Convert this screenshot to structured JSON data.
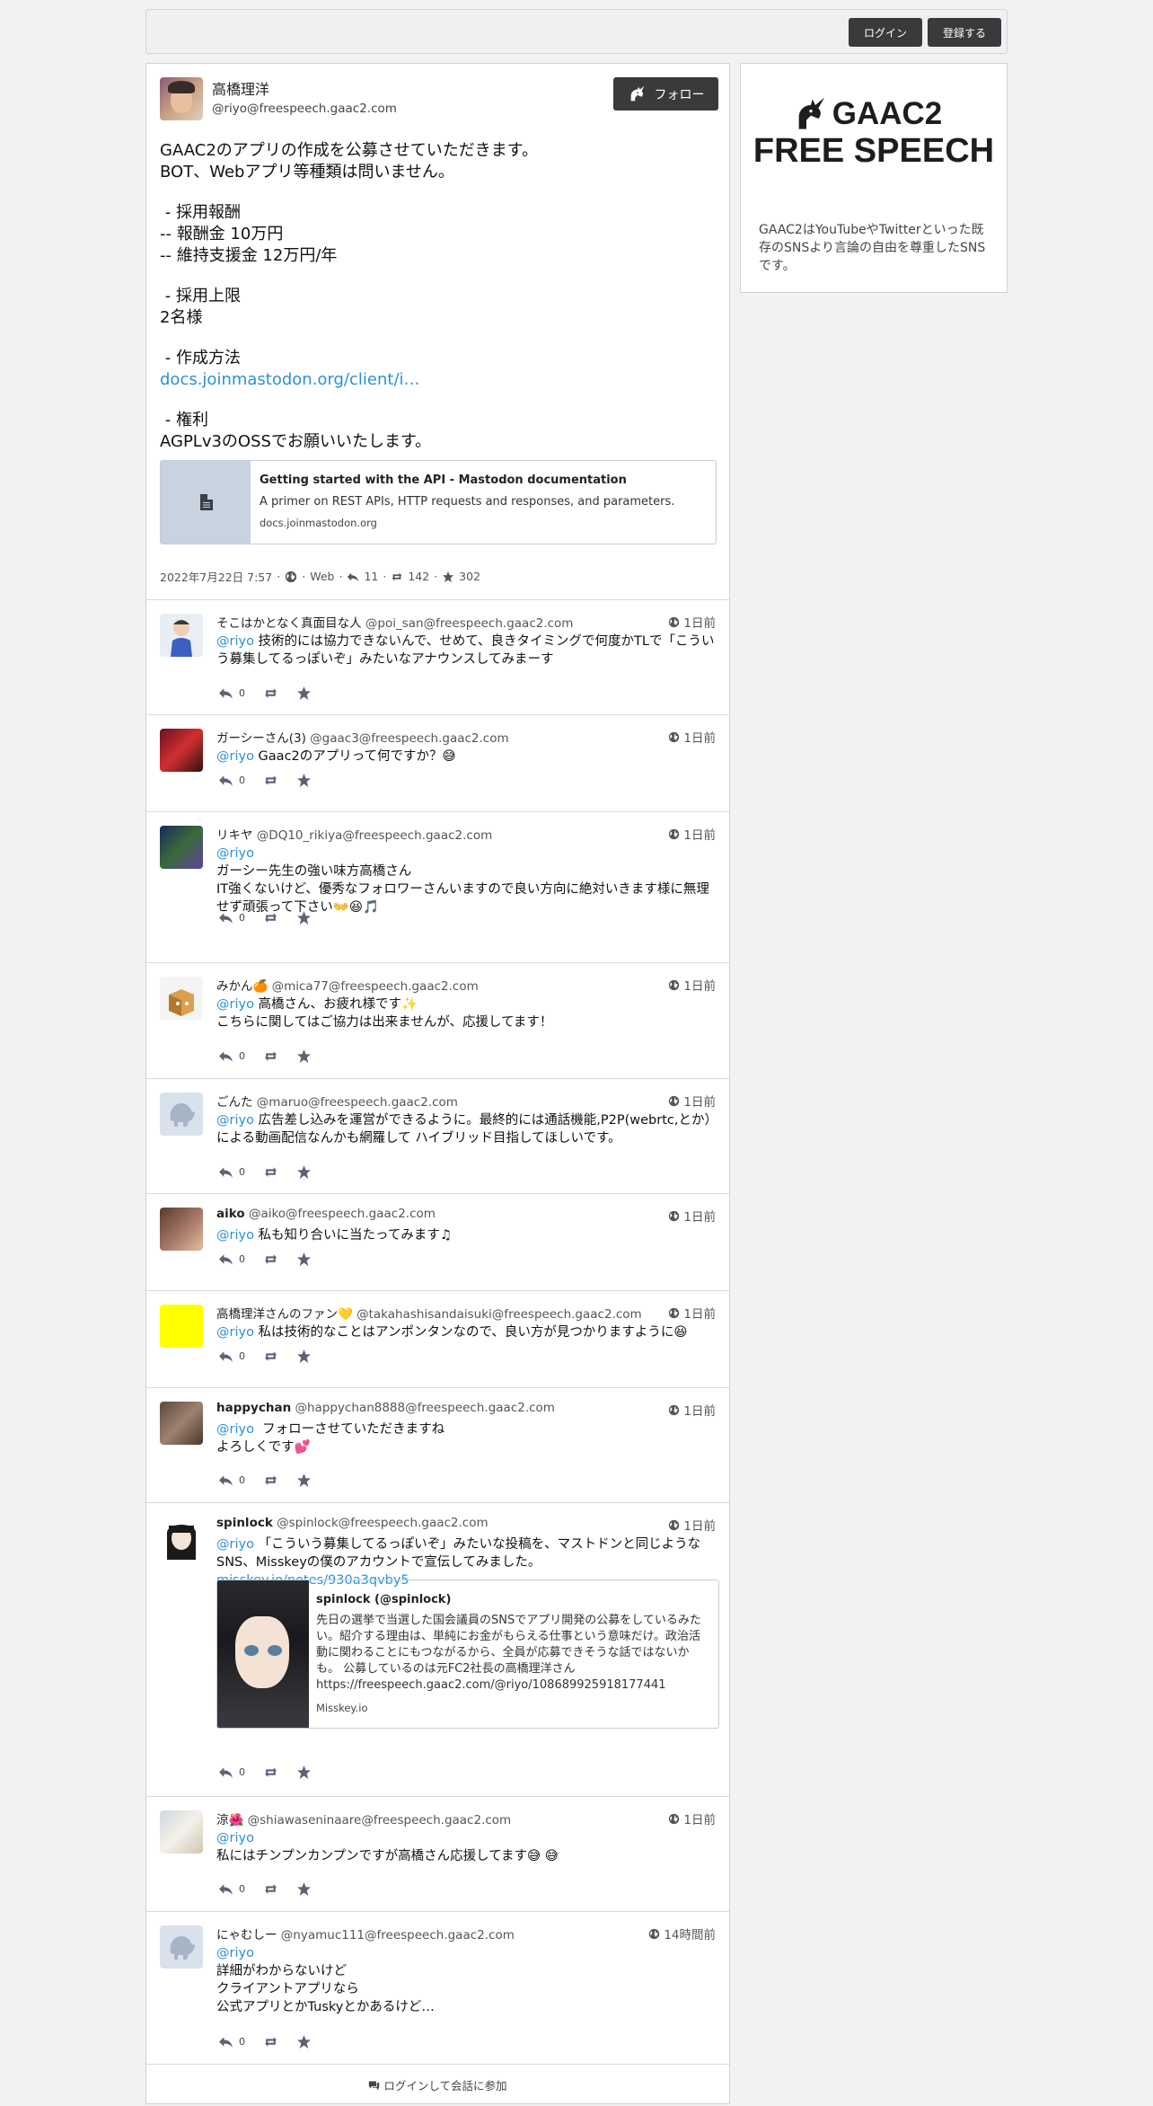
{
  "topbar": {
    "login": "ログイン",
    "register": "登録する"
  },
  "post": {
    "display_name": "高橋理洋",
    "acct": "@riyo@freespeech.gaac2.com",
    "follow": "フォロー",
    "paragraphs": [
      "GAAC2のアプリの作成を公募させていただきます。\nBOT、Webアプリ等種類は問いません。",
      " - 採用報酬\n-- 報酬金 10万円\n-- 維持支援金 12万円/年",
      " - 採用上限\n2名様",
      " - 作成方法"
    ],
    "link": "docs.joinmastodon.org/client/i…",
    "rights": " - 権利\nAGPLv3のOSSでお願いいたします。",
    "card": {
      "title": "Getting started with the API - Mastodon documentation",
      "description": "A primer on REST APIs, HTTP requests and responses, and parameters.",
      "host": "docs.joinmastodon.org"
    },
    "meta": {
      "date": "2022年7月22日 7:57",
      "app": "Web",
      "replies": "11",
      "boosts": "142",
      "favs": "302"
    }
  },
  "replies": [
    {
      "name": "そこはかとなく真面目な人",
      "bold": false,
      "acct": "@poi_san@freespeech.gaac2.com",
      "time": "1日前",
      "mention": "@riyo",
      "text": " 技術的には協力できないんで、せめて、良きタイミングで何度かTLで「こういう募集してるっぽいぞ」みたいなアナウンスしてみまーす",
      "count": "0"
    },
    {
      "name": "ガーシーさん(3)",
      "bold": false,
      "acct": "@gaac3@freespeech.gaac2.com",
      "time": "1日前",
      "mention": "@riyo",
      "text": " Gaac2のアプリって何ですか？😅",
      "count": "0"
    },
    {
      "name": "リキヤ",
      "bold": false,
      "acct": "@DQ10_rikiya@freespeech.gaac2.com",
      "time": "1日前",
      "mention": "@riyo",
      "text": "\nガーシー先生の強い味方高橋さん\nIT強くないけど、優秀なフォロワーさんいますので良い方向に絶対いきます様に無理せず頑張って下さい👐😆🎵",
      "count": "0"
    },
    {
      "name": "みかん🍊",
      "bold": false,
      "acct": "@mica77@freespeech.gaac2.com",
      "time": "1日前",
      "mention": "@riyo",
      "text": " 高橋さん、お疲れ様です✨\nこちらに関してはご協力は出来ませんが、応援してます！",
      "count": "0"
    },
    {
      "name": "ごんた",
      "bold": false,
      "acct": "@maruo@freespeech.gaac2.com",
      "time": "1日前",
      "mention": "@riyo",
      "text": " 広告差し込みを運営ができるように。最終的には通話機能,P2P(webrtc,とか）による動画配信なんかも網羅して ハイブリッド目指してほしいです。",
      "count": "0"
    },
    {
      "name": "aiko",
      "bold": true,
      "acct": "@aiko@freespeech.gaac2.com",
      "time": "1日前",
      "mention": "@riyo",
      "text": " 私も知り合いに当たってみます♫",
      "count": "0"
    },
    {
      "name": "高橋理洋さんのファン💛",
      "bold": false,
      "acct": "@takahashisandaisuki@freespeech.gaac2.com",
      "time": "1日前",
      "mention": "@riyo",
      "text": " 私は技術的なことはアンポンタンなので、良い方が見つかりますように😆",
      "count": "0"
    },
    {
      "name": "happychan",
      "bold": true,
      "acct": "@happychan8888@freespeech.gaac2.com",
      "time": "1日前",
      "mention": "@riyo",
      "text": "  フォローさせていただきますね\nよろしくです💕",
      "count": "0"
    },
    {
      "name": "spinlock",
      "bold": true,
      "acct": "@spinlock@freespeech.gaac2.com",
      "time": "1日前",
      "mention": "@riyo",
      "text": " 「こういう募集してるっぽいぞ」みたいな投稿を、マストドンと同じようなSNS、Misskeyの僕のアカウントで宣伝してみました。",
      "link": "misskey.io/notes/930a3qvby5",
      "count": "0",
      "embed": {
        "title": "spinlock (@spinlock)",
        "description": "先日の選挙で当選した国会議員のSNSでアプリ開発の公募をしているみたい。紹介する理由は、単純にお金がもらえる仕事という意味だけ。政治活動に関わることにもつながるから、全員が応募できそうな話ではないかも。 公募しているのは元FC2社長の高橋理洋さん https://freespeech.gaac2.com/@riyo/108689925918177441",
        "host": "Misskey.io"
      }
    },
    {
      "name": "涼🌺",
      "bold": false,
      "acct": "@shiawaseninaare@freespeech.gaac2.com",
      "time": "1日前",
      "mention": "@riyo",
      "text": "\n私にはチンプンカンプンですが高橋さん応援してます😅 😅",
      "count": "0"
    },
    {
      "name": "にゃむしー",
      "bold": false,
      "acct": "@nyamuc111@freespeech.gaac2.com",
      "time": "14時間前",
      "mention": "@riyo",
      "text": "\n詳細がわからないけど\nクライアントアプリなら\n公式アプリとかTuskyとかあるけど…",
      "count": "0"
    }
  ],
  "join": "ログインして会話に参加",
  "sidebar": {
    "logo_line1": "GAAC2",
    "logo_line2": "FREE SPEECH",
    "description": "GAAC2はYouTubeやTwitterといった既存のSNSより言論の自由を尊重したSNSです。"
  },
  "icons": [
    "reply-icon",
    "boost-icon",
    "star-icon",
    "globe-icon",
    "file-icon",
    "comments-icon",
    "unicorn-icon"
  ]
}
